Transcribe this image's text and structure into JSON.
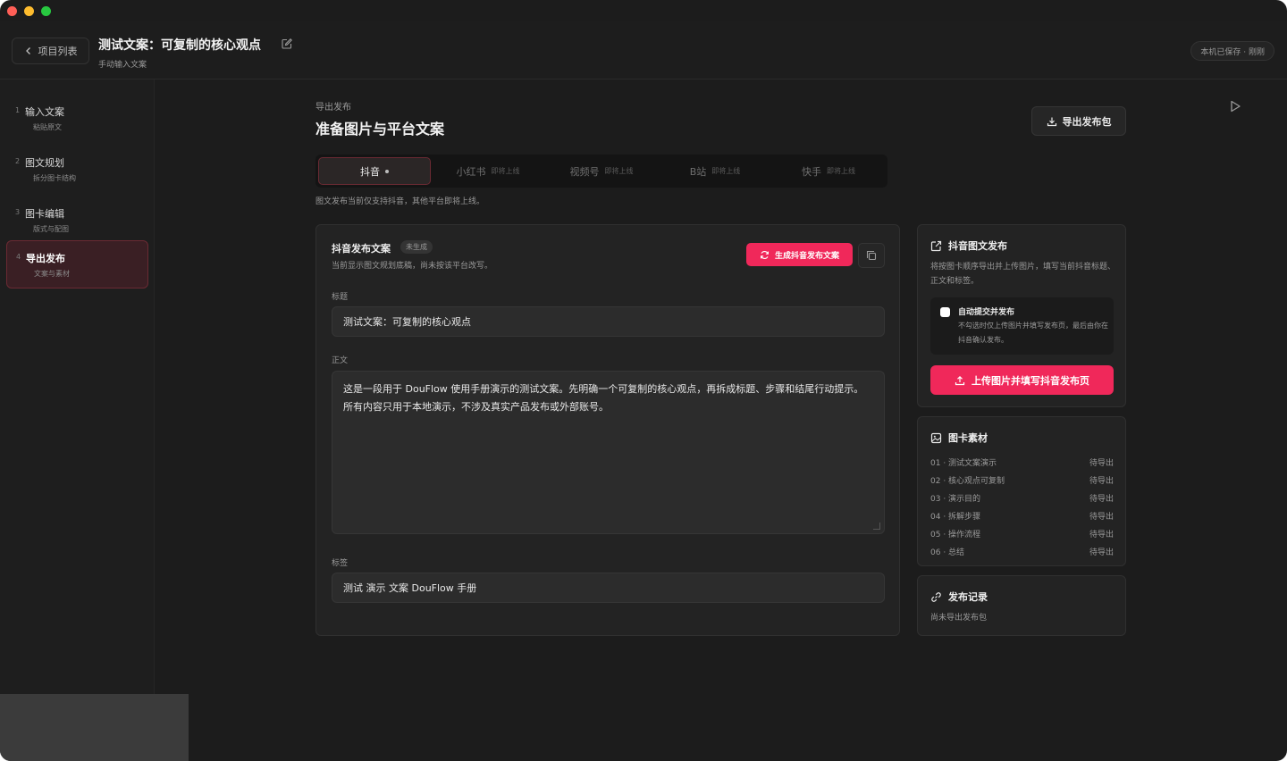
{
  "header": {
    "back_label": "项目列表",
    "title": "测试文案：可复制的核心观点",
    "subtitle": "手动输入文案",
    "save_status": "本机已保存 · 刚刚"
  },
  "steps": [
    {
      "num": "1",
      "label": "输入文案",
      "sub": "粘贴原文"
    },
    {
      "num": "2",
      "label": "图文规划",
      "sub": "拆分图卡结构"
    },
    {
      "num": "3",
      "label": "图卡编辑",
      "sub": "版式与配图"
    },
    {
      "num": "4",
      "label": "导出发布",
      "sub": "文案与素材"
    }
  ],
  "section": {
    "eyebrow": "导出发布",
    "title": "准备图片与平台文案",
    "export_label": "导出发布包"
  },
  "tabs": [
    {
      "label": "抖音",
      "soon": ""
    },
    {
      "label": "小红书",
      "soon": "即将上线"
    },
    {
      "label": "视频号",
      "soon": "即将上线"
    },
    {
      "label": "B站",
      "soon": "即将上线"
    },
    {
      "label": "快手",
      "soon": "即将上线"
    }
  ],
  "tabs_note": "图文发布当前仅支持抖音，其他平台即将上线。",
  "copy": {
    "title": "抖音发布文案",
    "badge": "未生成",
    "subtitle": "当前显示图文规划底稿，尚未按该平台改写。",
    "generate_label": "生成抖音发布文案",
    "title_label": "标题",
    "title_value": "测试文案：可复制的核心观点",
    "body_label": "正文",
    "body_value": "这是一段用于 DouFlow 使用手册演示的测试文案。先明确一个可复制的核心观点，再拆成标题、步骤和结尾行动提示。所有内容只用于本地演示，不涉及真实产品发布或外部账号。",
    "tags_label": "标签",
    "tags_value": "测试 演示 文案 DouFlow 手册"
  },
  "publish": {
    "title": "抖音图文发布",
    "desc": "将按图卡顺序导出并上传图片，填写当前抖音标题、正文和标签。",
    "auto_title": "自动提交并发布",
    "auto_desc": "不勾选时仅上传图片并填写发布页，最后由你在抖音确认发布。",
    "upload_label": "上传图片并填写抖音发布页"
  },
  "materials": {
    "title": "图卡素材",
    "items": [
      {
        "name": "01 · 测试文案演示",
        "status": "待导出"
      },
      {
        "name": "02 · 核心观点可复制",
        "status": "待导出"
      },
      {
        "name": "03 · 演示目的",
        "status": "待导出"
      },
      {
        "name": "04 · 拆解步骤",
        "status": "待导出"
      },
      {
        "name": "05 · 操作流程",
        "status": "待导出"
      },
      {
        "name": "06 · 总结",
        "status": "待导出"
      }
    ]
  },
  "log": {
    "title": "发布记录",
    "empty": "尚未导出发布包"
  },
  "colors": {
    "accent": "#f0285a",
    "background": "#1c1c1c",
    "panel": "#232323"
  }
}
